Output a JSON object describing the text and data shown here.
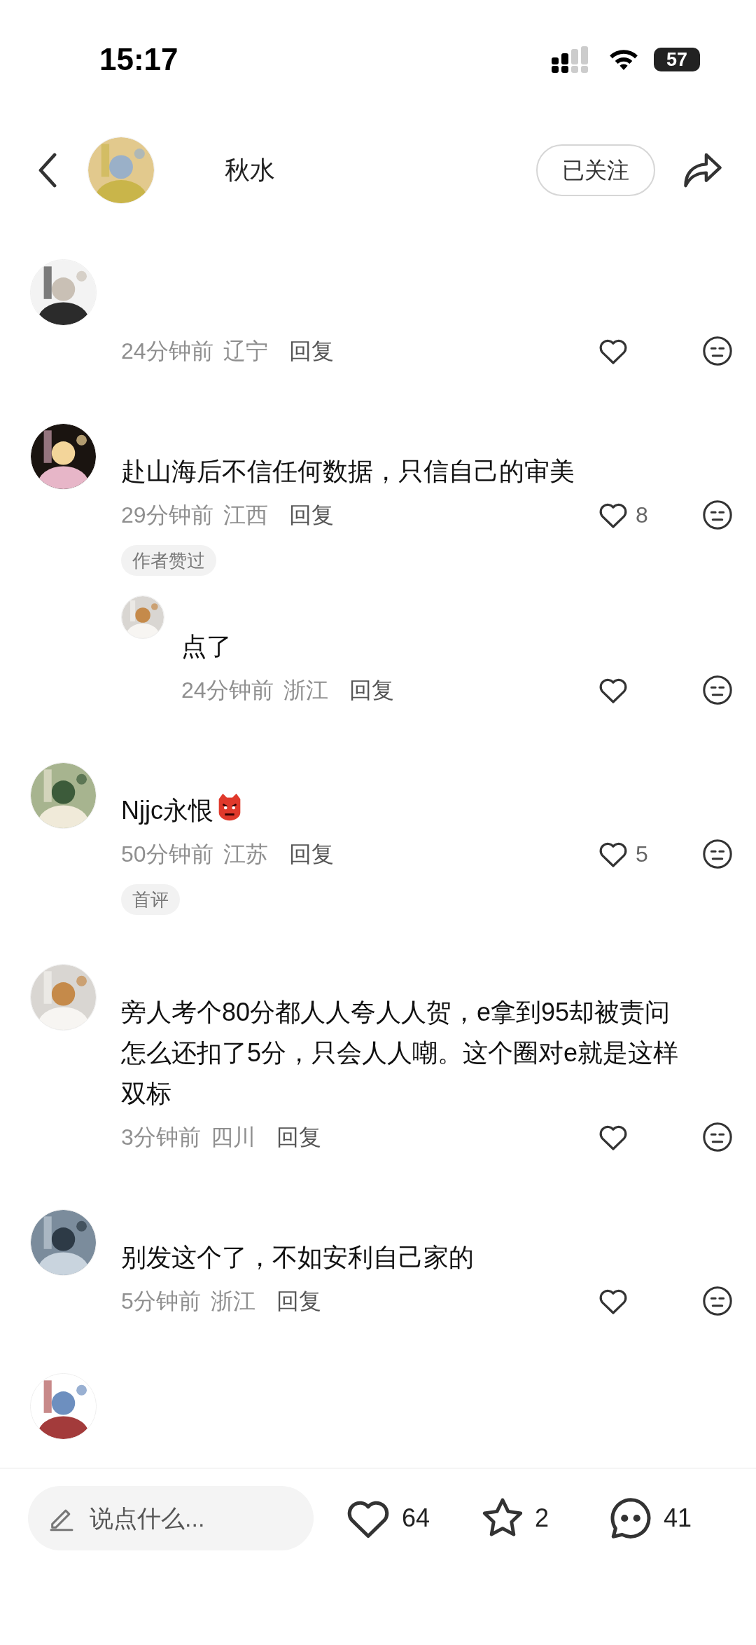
{
  "status_bar": {
    "time": "15:17",
    "battery": "57"
  },
  "header": {
    "name": "秋水",
    "follow_label": "已关注",
    "followed": true
  },
  "comments": [
    {
      "time": "24分钟前",
      "location": "辽宁",
      "reply_label": "回复",
      "avatar": {
        "kind": "picture"
      }
    },
    {
      "text": "赴山海后不信任何数据，只信自己的审美",
      "time": "29分钟前",
      "location": "江西",
      "reply_label": "回复",
      "likes": "8",
      "tag": "作者赞过",
      "avatar": {
        "kind": "picture"
      },
      "replies": [
        {
          "text": "点了",
          "time": "24分钟前",
          "location": "浙江",
          "reply_label": "回复",
          "avatar": {
            "kind": "picture"
          }
        }
      ]
    },
    {
      "text": "Njjc永恨",
      "trailing_icon": {
        "kind": "angry-face"
      },
      "time": "50分钟前",
      "location": "江苏",
      "reply_label": "回复",
      "likes": "5",
      "tag": "首评",
      "avatar": {
        "kind": "picture"
      }
    },
    {
      "text": "旁人考个80分都人人夸人人贺，e拿到95却被责问怎么还扣了5分，只会人人嘲。这个圈对e就是这样双标",
      "time": "3分钟前",
      "location": "四川",
      "reply_label": "回复",
      "avatar": {
        "kind": "picture"
      }
    },
    {
      "text": "别发这个了，不如安利自己家的",
      "time": "5分钟前",
      "location": "浙江",
      "reply_label": "回复",
      "avatar": {
        "kind": "picture"
      }
    },
    {
      "avatar": {
        "kind": "picture"
      }
    }
  ],
  "bottom_bar": {
    "placeholder": "说点什么...",
    "likes": "64",
    "favorites": "2",
    "comments": "41"
  }
}
